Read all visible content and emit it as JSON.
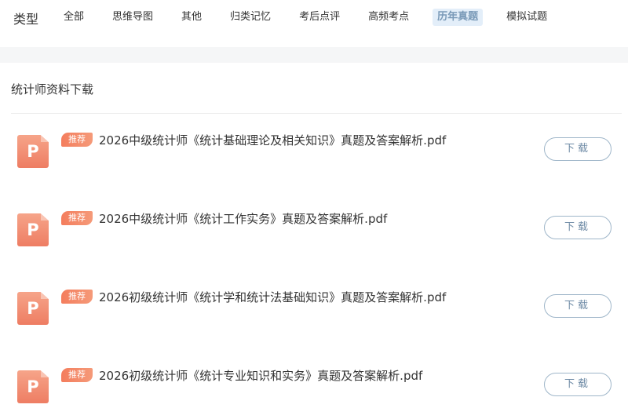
{
  "filter_bar": {
    "type_label": "类型",
    "tabs": [
      {
        "label": "全部",
        "active": false
      },
      {
        "label": "思维导图",
        "active": false
      },
      {
        "label": "其他",
        "active": false
      },
      {
        "label": "归类记忆",
        "active": false
      },
      {
        "label": "考后点评",
        "active": false
      },
      {
        "label": "高频考点",
        "active": false
      },
      {
        "label": "历年真题",
        "active": true
      },
      {
        "label": "模拟试题",
        "active": false
      }
    ]
  },
  "section": {
    "title": "统计师资料下载"
  },
  "files": [
    {
      "icon_letter": "P",
      "badge": "推荐",
      "name": "2026中级统计师《统计基础理论及相关知识》真题及答案解析.pdf",
      "button": "下载"
    },
    {
      "icon_letter": "P",
      "badge": "推荐",
      "name": "2026中级统计师《统计工作实务》真题及答案解析.pdf",
      "button": "下载"
    },
    {
      "icon_letter": "P",
      "badge": "推荐",
      "name": "2026初级统计师《统计学和统计法基础知识》真题及答案解析.pdf",
      "button": "下载"
    },
    {
      "icon_letter": "P",
      "badge": "推荐",
      "name": "2026初级统计师《统计专业知识和实务》真题及答案解析.pdf",
      "button": "下载"
    }
  ],
  "colors": {
    "active_tab_bg": "#e3eef9",
    "active_tab_text": "#7a9ab8",
    "badge": "#f47d5d",
    "file_icon": "#ee7d63",
    "button_border": "#9fb6c9",
    "button_text": "#6f8ba6"
  },
  "icons": {
    "file": "pdf-file-icon"
  }
}
